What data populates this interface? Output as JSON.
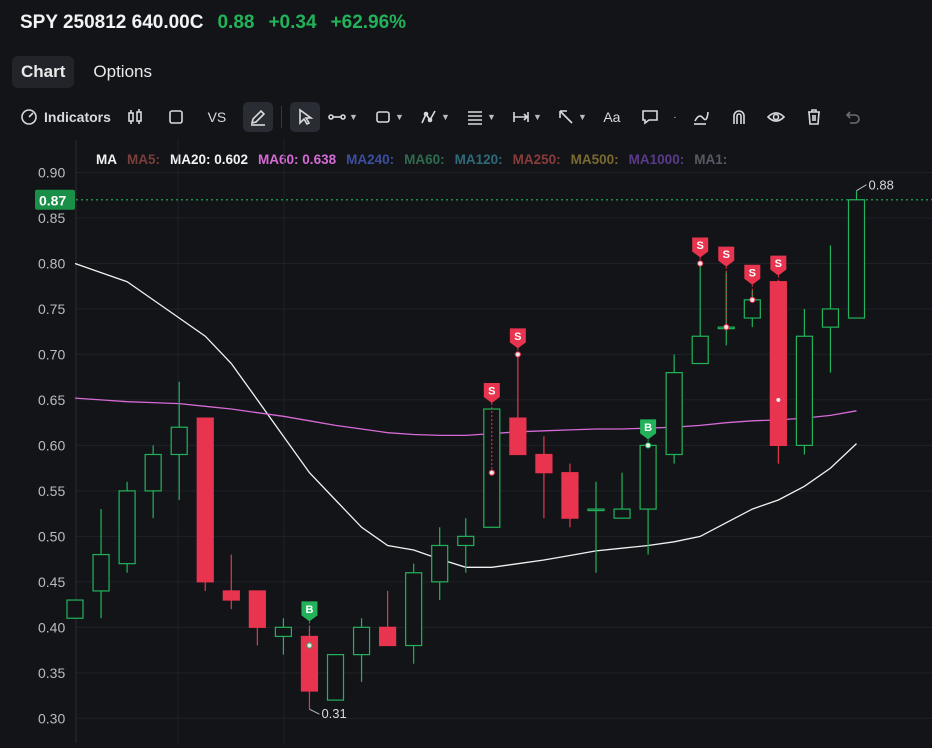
{
  "header": {
    "symbol": "SPY 250812 640.00C",
    "last": "0.88",
    "change": "+0.34",
    "change_pct": "+62.96%",
    "up_color": "#22b35a"
  },
  "tabs": [
    {
      "label": "Chart",
      "active": true
    },
    {
      "label": "Options",
      "active": false
    }
  ],
  "toolbar": {
    "indicators_label": "Indicators",
    "vs_label": "VS",
    "text_tool_label": "Aa"
  },
  "ma_legend": {
    "title": "MA",
    "items": [
      {
        "label": "MA5:",
        "color": "#7a3f3a"
      },
      {
        "label": "MA20: 0.602",
        "color": "#f2f2f2"
      },
      {
        "label": "MA60: 0.638",
        "color": "#d66ad6"
      },
      {
        "label": "MA240:",
        "color": "#3b4ea0"
      },
      {
        "label": "MA60:",
        "color": "#2f6b4f"
      },
      {
        "label": "MA120:",
        "color": "#2f6a7a"
      },
      {
        "label": "MA250:",
        "color": "#8a3b3b"
      },
      {
        "label": "MA500:",
        "color": "#7a6a2f"
      },
      {
        "label": "MA1000:",
        "color": "#5a3a8a"
      },
      {
        "label": "MA1:",
        "color": "#555a63"
      }
    ]
  },
  "chart_data": {
    "type": "candlestick",
    "ylim": [
      0.295,
      0.915
    ],
    "yticks": [
      "0.90",
      "0.85",
      "0.80",
      "0.75",
      "0.70",
      "0.65",
      "0.60",
      "0.55",
      "0.50",
      "0.45",
      "0.40",
      "0.35",
      "0.30"
    ],
    "current_price_label": "0.87",
    "current_price": 0.87,
    "high_label": "0.88",
    "low_label": "0.31",
    "up_color": "#22b35a",
    "down_color": "#e8344e",
    "candles": [
      {
        "o": 0.41,
        "h": 0.43,
        "l": 0.41,
        "c": 0.43
      },
      {
        "o": 0.44,
        "h": 0.53,
        "l": 0.41,
        "c": 0.48
      },
      {
        "o": 0.47,
        "h": 0.56,
        "l": 0.46,
        "c": 0.55
      },
      {
        "o": 0.55,
        "h": 0.6,
        "l": 0.52,
        "c": 0.59
      },
      {
        "o": 0.59,
        "h": 0.67,
        "l": 0.54,
        "c": 0.62
      },
      {
        "o": 0.63,
        "h": 0.63,
        "l": 0.44,
        "c": 0.45
      },
      {
        "o": 0.44,
        "h": 0.48,
        "l": 0.42,
        "c": 0.43
      },
      {
        "o": 0.44,
        "h": 0.44,
        "l": 0.38,
        "c": 0.4
      },
      {
        "o": 0.39,
        "h": 0.41,
        "l": 0.37,
        "c": 0.4
      },
      {
        "o": 0.39,
        "h": 0.4,
        "l": 0.31,
        "c": 0.33
      },
      {
        "o": 0.32,
        "h": 0.37,
        "l": 0.32,
        "c": 0.37
      },
      {
        "o": 0.37,
        "h": 0.41,
        "l": 0.34,
        "c": 0.4
      },
      {
        "o": 0.4,
        "h": 0.44,
        "l": 0.38,
        "c": 0.38
      },
      {
        "o": 0.38,
        "h": 0.47,
        "l": 0.36,
        "c": 0.46
      },
      {
        "o": 0.45,
        "h": 0.51,
        "l": 0.43,
        "c": 0.49
      },
      {
        "o": 0.49,
        "h": 0.52,
        "l": 0.46,
        "c": 0.5
      },
      {
        "o": 0.51,
        "h": 0.64,
        "l": 0.51,
        "c": 0.64
      },
      {
        "o": 0.63,
        "h": 0.7,
        "l": 0.59,
        "c": 0.59
      },
      {
        "o": 0.59,
        "h": 0.61,
        "l": 0.52,
        "c": 0.57
      },
      {
        "o": 0.57,
        "h": 0.58,
        "l": 0.51,
        "c": 0.52
      },
      {
        "o": 0.53,
        "h": 0.56,
        "l": 0.46,
        "c": 0.53
      },
      {
        "o": 0.52,
        "h": 0.57,
        "l": 0.52,
        "c": 0.53
      },
      {
        "o": 0.53,
        "h": 0.6,
        "l": 0.48,
        "c": 0.6
      },
      {
        "o": 0.59,
        "h": 0.7,
        "l": 0.58,
        "c": 0.68
      },
      {
        "o": 0.69,
        "h": 0.8,
        "l": 0.69,
        "c": 0.72
      },
      {
        "o": 0.73,
        "h": 0.79,
        "l": 0.71,
        "c": 0.73
      },
      {
        "o": 0.74,
        "h": 0.77,
        "l": 0.73,
        "c": 0.76
      },
      {
        "o": 0.78,
        "h": 0.78,
        "l": 0.58,
        "c": 0.6
      },
      {
        "o": 0.6,
        "h": 0.75,
        "l": 0.59,
        "c": 0.72
      },
      {
        "o": 0.73,
        "h": 0.82,
        "l": 0.68,
        "c": 0.75
      },
      {
        "o": 0.74,
        "h": 0.88,
        "l": 0.74,
        "c": 0.87
      }
    ],
    "series": [
      {
        "name": "MA20",
        "color": "#f2f2f2",
        "values": [
          0.8,
          0.79,
          0.78,
          0.76,
          0.74,
          0.72,
          0.69,
          0.65,
          0.61,
          0.57,
          0.54,
          0.51,
          0.49,
          0.485,
          0.475,
          0.466,
          0.466,
          0.47,
          0.474,
          0.479,
          0.484,
          0.487,
          0.49,
          0.494,
          0.5,
          0.515,
          0.53,
          0.54,
          0.555,
          0.575,
          0.602
        ]
      },
      {
        "name": "MA60",
        "color": "#d66ad6",
        "values": [
          0.652,
          0.65,
          0.648,
          0.647,
          0.646,
          0.643,
          0.64,
          0.636,
          0.632,
          0.627,
          0.622,
          0.618,
          0.614,
          0.612,
          0.611,
          0.611,
          0.613,
          0.615,
          0.616,
          0.617,
          0.618,
          0.618,
          0.619,
          0.62,
          0.622,
          0.625,
          0.627,
          0.628,
          0.63,
          0.633,
          0.638
        ]
      }
    ],
    "signals": [
      {
        "i": 9,
        "type": "B",
        "price": 0.38
      },
      {
        "i": 16,
        "type": "S",
        "price": 0.57
      },
      {
        "i": 17,
        "type": "S",
        "price": 0.7
      },
      {
        "i": 22,
        "type": "B",
        "price": 0.6
      },
      {
        "i": 24,
        "type": "S",
        "price": 0.8
      },
      {
        "i": 25,
        "type": "S",
        "price": 0.73
      },
      {
        "i": 26,
        "type": "S",
        "price": 0.76
      },
      {
        "i": 27,
        "type": "S",
        "price": 0.65
      }
    ]
  }
}
